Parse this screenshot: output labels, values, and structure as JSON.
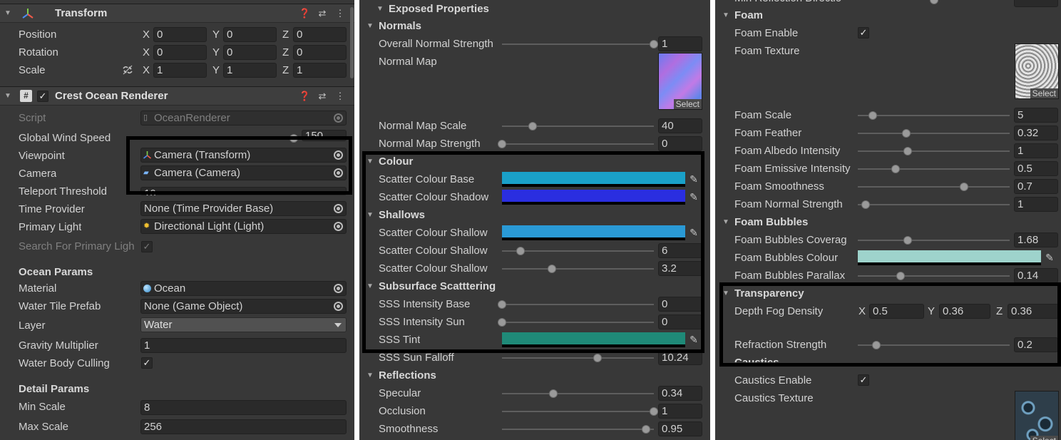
{
  "panel1": {
    "transform": {
      "title": "Transform",
      "position_label": "Position",
      "rotation_label": "Rotation",
      "scale_label": "Scale",
      "axis_x": "X",
      "axis_y": "Y",
      "axis_z": "Z",
      "position": [
        "0",
        "0",
        "0"
      ],
      "rotation": [
        "0",
        "0",
        "0"
      ],
      "scale": [
        "1",
        "1",
        "1"
      ]
    },
    "renderer": {
      "title": "Crest Ocean Renderer",
      "script_label": "Script",
      "script_value": "OceanRenderer",
      "wind_label": "Global Wind Speed",
      "wind_value": "150",
      "viewpoint_label": "Viewpoint",
      "viewpoint_value": "Camera (Transform)",
      "camera_label": "Camera",
      "camera_value": "Camera (Camera)",
      "teleport_label": "Teleport Threshold",
      "teleport_value": "10",
      "time_label": "Time Provider",
      "time_value": "None (Time Provider Base)",
      "light_label": "Primary Light",
      "light_value": "Directional Light (Light)",
      "search_label": "Search For Primary Ligh",
      "ocean_params": "Ocean Params",
      "material_label": "Material",
      "material_value": "Ocean",
      "tile_label": "Water Tile Prefab",
      "tile_value": "None (Game Object)",
      "layer_label": "Layer",
      "layer_value": "Water",
      "gravity_label": "Gravity Multiplier",
      "gravity_value": "1",
      "culling_label": "Water Body Culling",
      "detail_params": "Detail Params",
      "min_scale_label": "Min Scale",
      "min_scale_value": "8",
      "max_scale_label": "Max Scale",
      "max_scale_value": "256"
    }
  },
  "panel2": {
    "exposed": "Exposed Properties",
    "normals": "Normals",
    "overall_normal_label": "Overall Normal Strength",
    "overall_normal_value": "1",
    "normal_map_label": "Normal Map",
    "select_label": "Select",
    "normal_map_scale_label": "Normal Map Scale",
    "normal_map_scale_value": "40",
    "normal_map_strength_label": "Normal Map Strength",
    "normal_map_strength_value": "0",
    "colour": "Colour",
    "scatter_base_label": "Scatter Colour Base",
    "scatter_shadow_label": "Scatter Colour Shadow",
    "shallows": "Shallows",
    "scatter_shallow_label": "Scatter Colour Shallow",
    "shallow_depth_value": "6",
    "shallow_falloff_value": "3.2",
    "subsurface": "Subsurface Scatttering",
    "sss_base_label": "SSS Intensity Base",
    "sss_base_value": "0",
    "sss_sun_label": "SSS Intensity Sun",
    "sss_sun_value": "0",
    "sss_tint_label": "SSS Tint",
    "sss_falloff_label": "SSS Sun Falloff",
    "sss_falloff_value": "10.24",
    "reflections": "Reflections",
    "specular_label": "Specular",
    "specular_value": "0.34",
    "occlusion_label": "Occlusion",
    "occlusion_value": "1",
    "smoothness_label": "Smoothness",
    "smoothness_value": "0.95",
    "colors": {
      "scatter_base": "#1aa0c8",
      "scatter_shadow": "#2a2ee0",
      "scatter_shallow": "#2a9ad6",
      "sss_tint": "#1f8a78"
    },
    "sliders": {
      "overall_normal": 1.0,
      "normal_map_scale": 0.2,
      "normal_map_strength": 0.0,
      "shallow_depth": 0.12,
      "shallow_falloff": 0.33,
      "sss_base": 0.0,
      "sss_sun": 0.0,
      "sss_falloff": 0.63,
      "specular": 0.34,
      "occlusion": 1.0,
      "smoothness": 0.95
    }
  },
  "panel3": {
    "cut_top_label": "Min Reflection Directio",
    "foam": "Foam",
    "foam_enable_label": "Foam Enable",
    "foam_texture_label": "Foam Texture",
    "select_label": "Select",
    "foam_scale_label": "Foam Scale",
    "foam_scale_value": "5",
    "foam_feather_label": "Foam Feather",
    "foam_feather_value": "0.32",
    "foam_albedo_label": "Foam Albedo Intensity",
    "foam_albedo_value": "1",
    "foam_emissive_label": "Foam Emissive Intensity",
    "foam_emissive_value": "0.5",
    "foam_smooth_label": "Foam Smoothness",
    "foam_smooth_value": "0.7",
    "foam_normal_label": "Foam Normal Strength",
    "foam_normal_value": "1",
    "foam_bubbles": "Foam Bubbles",
    "bubbles_coverage_label": "Foam Bubbles Coverag",
    "bubbles_coverage_value": "1.68",
    "bubbles_colour_label": "Foam Bubbles Colour",
    "bubbles_parallax_label": "Foam Bubbles Parallax",
    "bubbles_parallax_value": "0.14",
    "transparency": "Transparency",
    "depth_fog_label": "Depth Fog Density",
    "axis_x": "X",
    "axis_y": "Y",
    "axis_z": "Z",
    "depth_fog": [
      "0.5",
      "0.36",
      "0.36"
    ],
    "refraction_label": "Refraction Strength",
    "refraction_value": "0.2",
    "caustics": "Caustics",
    "caustics_enable_label": "Caustics Enable",
    "caustics_texture_label": "Caustics Texture",
    "colors": {
      "bubbles_colour": "#9ed3cc"
    },
    "sliders": {
      "foam_scale": 0.1,
      "foam_feather": 0.32,
      "foam_albedo": 0.33,
      "foam_emissive": 0.25,
      "foam_smooth": 0.7,
      "foam_normal": 0.05,
      "bubbles_coverage": 0.33,
      "bubbles_parallax": 0.28,
      "refraction": 0.12
    }
  }
}
